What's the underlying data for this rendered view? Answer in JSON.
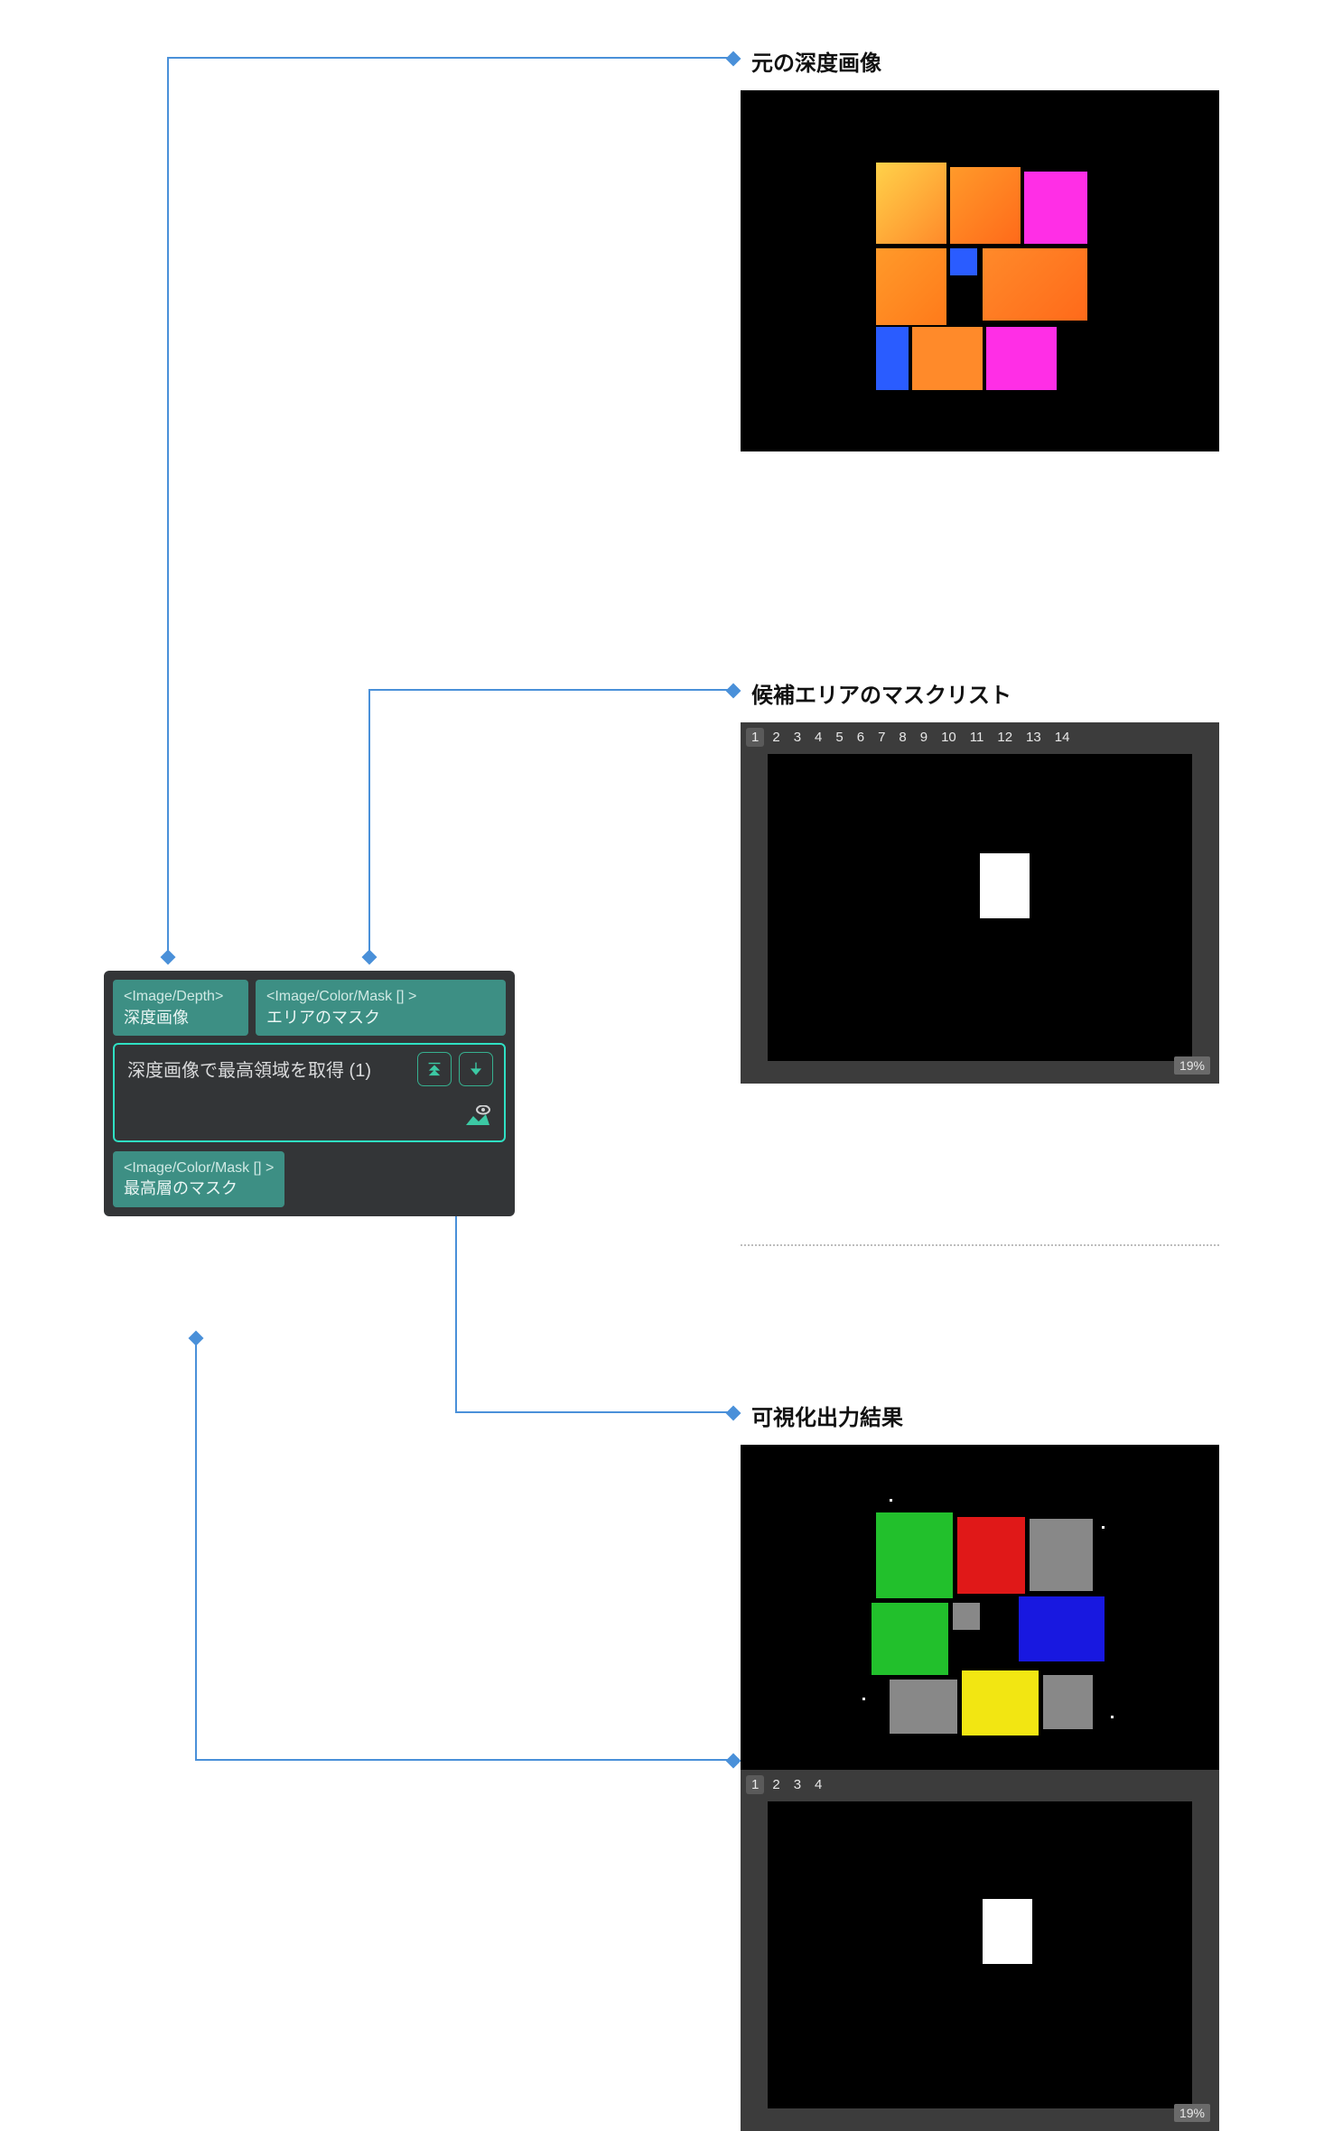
{
  "titles": {
    "depth_input": "元の深度画像",
    "mask_list": "候補エリアのマスクリスト",
    "vis_output": "可視化出力結果"
  },
  "node": {
    "input_depth_type": "<Image/Depth>",
    "input_depth_label": "深度画像",
    "input_mask_type": "<Image/Color/Mask [] >",
    "input_mask_label": "エリアのマスク",
    "title": "深度画像で最高領域を取得 (1)",
    "output_type": "<Image/Color/Mask [] >",
    "output_label": "最高層のマスク",
    "btn_expand": "expand-down-icon",
    "btn_collapse": "collapse-down-icon",
    "btn_vis": "visualize-icon"
  },
  "mask_list_panel": {
    "tabs": [
      "1",
      "2",
      "3",
      "4",
      "5",
      "6",
      "7",
      "8",
      "9",
      "10",
      "11",
      "12",
      "13",
      "14"
    ],
    "selected": "1",
    "zoom": "19%"
  },
  "output_mask_panel": {
    "tabs": [
      "1",
      "2",
      "3",
      "4"
    ],
    "selected": "1",
    "zoom": "19%"
  },
  "colors": {
    "connector": "#4a90d9",
    "teal": "#3d8f84",
    "teal_border": "#2fe0c3"
  }
}
